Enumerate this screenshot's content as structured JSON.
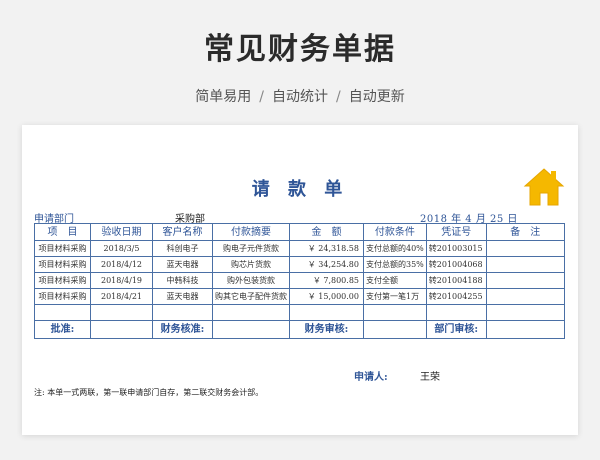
{
  "header": {
    "title": "常见财务单据",
    "features": [
      "简单易用",
      "自动统计",
      "自动更新"
    ],
    "separator": "/"
  },
  "form": {
    "title": "请 款 单",
    "dept_label": "申请部门",
    "dept_value": "采购部",
    "date_text": "2018 年  4  月  25   日",
    "columns": [
      "项　目",
      "验收日期",
      "客户名称",
      "付款摘要",
      "金　额",
      "付款条件",
      "凭证号",
      "备　注"
    ],
    "rows": [
      [
        "项目材料采购",
        "2018/3/5",
        "科创电子",
        "购电子元件货款",
        "￥  24,318.58",
        "支付总额的40%",
        "转201003015",
        ""
      ],
      [
        "项目材料采购",
        "2018/4/12",
        "蓝天电器",
        "购芯片货款",
        "￥  34,254.80",
        "支付总额的35%",
        "转201004068",
        ""
      ],
      [
        "项目材料采购",
        "2018/4/19",
        "中韩科技",
        "购外包装货款",
        "￥    7,800.85",
        "支付全额",
        "转201004188",
        ""
      ],
      [
        "项目材料采购",
        "2018/4/21",
        "蓝天电器",
        "购其它电子配件货款",
        "￥  15,000.00",
        "支付第一笔1万",
        "转201004255",
        ""
      ]
    ],
    "signatures": [
      "批准:",
      "财务核准:",
      "财务审核:",
      "部门审核:"
    ],
    "applicant_label": "申请人:",
    "applicant_value": "王荣",
    "note": "注: 本单一式两联，第一联申请部门自存，第二联交财务会计部。"
  },
  "icons": {
    "home": "home-icon"
  },
  "colors": {
    "accent": "#2f5597",
    "home_icon": "#f5b800"
  }
}
